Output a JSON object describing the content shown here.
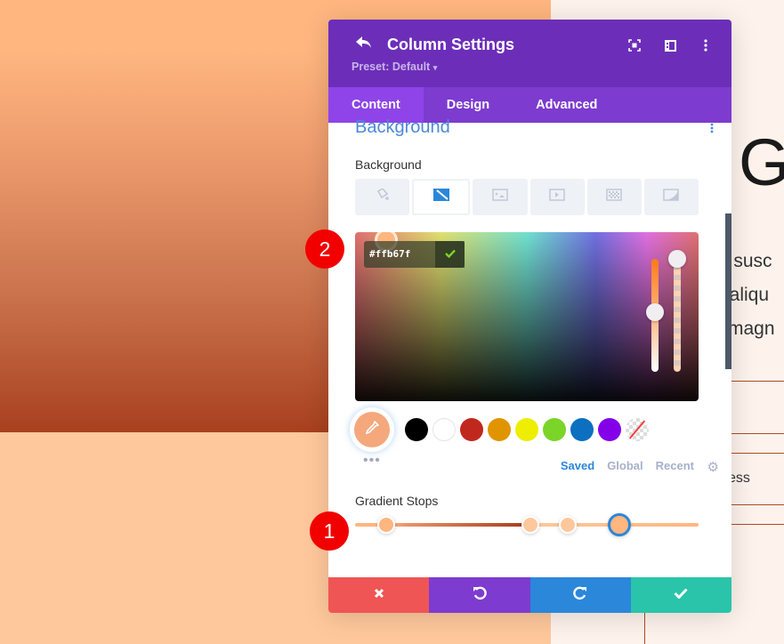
{
  "page_background": {
    "heading_glyph": "G",
    "text_lines": [
      "s susc",
      "t aliqu",
      "magn"
    ],
    "side_text": "ess",
    "colors": {
      "gradient_top": "#ffb67f",
      "gradient_bottom": "#a8401e",
      "lower_fill": "#ffc89c"
    }
  },
  "modal": {
    "title": "Column Settings",
    "preset": "Preset: Default",
    "preset_caret": "▾",
    "header_icons": [
      "back-icon",
      "fullscreen-icon",
      "split-view-icon",
      "more-options-icon"
    ],
    "tabs": [
      {
        "label": "Content",
        "active": true
      },
      {
        "label": "Design",
        "active": false
      },
      {
        "label": "Advanced",
        "active": false
      }
    ],
    "section_title": "Background",
    "background_label": "Background",
    "background_types": [
      {
        "icon": "color-fill-icon",
        "active": false
      },
      {
        "icon": "gradient-icon",
        "active": true
      },
      {
        "icon": "image-icon",
        "active": false
      },
      {
        "icon": "video-icon",
        "active": false
      },
      {
        "icon": "pattern-icon",
        "active": false
      },
      {
        "icon": "mask-icon",
        "active": false
      }
    ],
    "color_picker": {
      "hex_value": "#ffb67f",
      "confirm_icon": "check-icon"
    },
    "swatches": [
      "#000000",
      "#ffffff",
      "#c0281d",
      "#e09400",
      "#eeee00",
      "#7bd428",
      "#0c6fc0",
      "#8300e9",
      "none"
    ],
    "eyedropper_color": "#f4a87c",
    "more_label": "•••",
    "palette_tabs": [
      {
        "label": "Saved",
        "active": true
      },
      {
        "label": "Global",
        "active": false
      },
      {
        "label": "Recent",
        "active": false
      }
    ],
    "gradient_stops_label": "Gradient Stops",
    "gradient_stops": [
      {
        "color": "#ffb67f",
        "position_pct": 9,
        "selected": false
      },
      {
        "color": "#ffc89c",
        "position_pct": 51,
        "selected": false
      },
      {
        "color": "#ffc89c",
        "position_pct": 62,
        "selected": false
      },
      {
        "color": "#ffb67f",
        "position_pct": 77,
        "selected": true
      }
    ],
    "footer_buttons": [
      {
        "name": "cancel",
        "icon": "✖",
        "color": "#ef5555"
      },
      {
        "name": "undo",
        "icon": "↺",
        "color": "#7e3bd0"
      },
      {
        "name": "redo",
        "icon": "↻",
        "color": "#2b87da"
      },
      {
        "name": "save",
        "icon": "✔",
        "color": "#29c4a9"
      }
    ]
  },
  "annotations": [
    {
      "label": "1"
    },
    {
      "label": "2"
    }
  ]
}
